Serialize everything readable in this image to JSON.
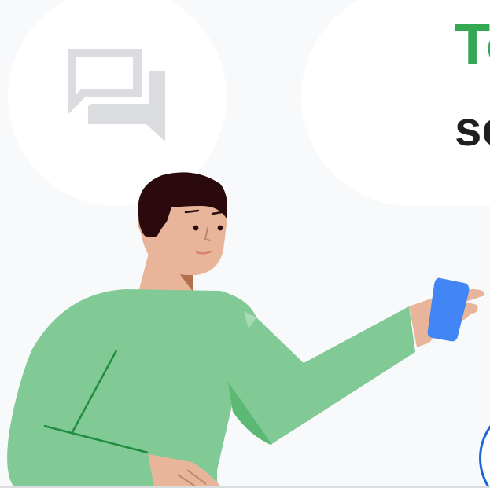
{
  "headline": {
    "text": "To"
  },
  "subline": {
    "text": "se"
  },
  "icons": {
    "chat": "forum-chat-icon",
    "phone": "smartphone-icon"
  },
  "colors": {
    "background": "#f8f9fb",
    "card": "#ffffff",
    "headline": "#34a853",
    "body_text": "#1f1f1f",
    "icon_gray": "#dadce0",
    "shirt": "#81c995",
    "shirt_dark": "#5bb974",
    "shirt_line": "#1e8e3e",
    "skin": "#e8b59a",
    "hair": "#2b0a0e",
    "phone": "#4285f4",
    "ring": "#1a66d9"
  }
}
